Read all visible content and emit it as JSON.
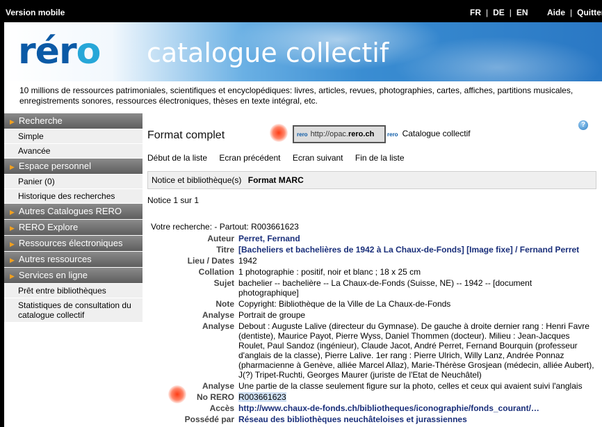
{
  "topbar": {
    "mobile": "Version mobile",
    "langs": [
      "FR",
      "DE",
      "EN"
    ],
    "help": "Aide",
    "quit": "Quitter"
  },
  "banner": {
    "logo": "rero",
    "title": "catalogue collectif"
  },
  "description": "10 millions de ressources patrimoniales, scientifiques et encyclopédiques: livres, articles, revues, photographies, cartes, affiches, partitions musicales, enregistrements sonores, ressources électroniques, thèses en texte intégral, etc.",
  "sidebar": {
    "recherche": "Recherche",
    "simple": "Simple",
    "avancee": "Avancée",
    "espace": "Espace personnel",
    "panier": "Panier (0)",
    "historique": "Historique des recherches",
    "autres_catalogues": "Autres Catalogues RERO",
    "explore": "RERO Explore",
    "ressources_elec": "Ressources électroniques",
    "autres_ressources": "Autres ressources",
    "services": "Services en ligne",
    "pret": "Prêt entre bibliothèques",
    "stats": "Statistiques de consultation du catalogue collectif"
  },
  "main": {
    "format_title": "Format complet",
    "url_prefix": "http://opac.",
    "url_bold": "rero.ch",
    "url_mini": "rero",
    "catalogue_label": "Catalogue collectif",
    "catalogue_mini": "rero",
    "help": "?",
    "nav": {
      "debut": "Début de la liste",
      "precedent": "Ecran précédent",
      "suivant": "Ecran suivant",
      "fin": "Fin de la liste"
    },
    "tabs": {
      "notice": "Notice et bibliothèque(s)",
      "marc": "Format MARC"
    },
    "notice_count": "Notice 1 sur 1",
    "recherche": "Votre recherche: - Partout: R003661623"
  },
  "record": {
    "auteur_l": "Auteur",
    "auteur": "Perret, Fernand",
    "titre_l": "Titre",
    "titre": "[Bacheliers et bachelières de 1942 à La Chaux-de-Fonds] [Image fixe] / Fernand Perret",
    "lieu_l": "Lieu / Dates",
    "lieu": "1942",
    "collation_l": "Collation",
    "collation": "1 photographie : positif, noir et blanc ; 18 x 25 cm",
    "sujet_l": "Sujet",
    "sujet": "bachelier -- bachelière -- La Chaux-de-Fonds (Suisse, NE) -- 1942 -- [document photographique]",
    "note_l": "Note",
    "note": "Copyright: Bibliothèque de la Ville de La Chaux-de-Fonds",
    "analyse1_l": "Analyse",
    "analyse1": "Portrait de groupe",
    "analyse2_l": "Analyse",
    "analyse2": "Debout : Auguste Lalive (directeur du Gymnase). De gauche à droite dernier rang : Henri Favre (dentiste), Maurice Payot, Pierre Wyss, Daniel Thommen (docteur). Milieu : Jean-Jacques Roulet, Paul Sandoz (ingénieur), Claude Jacot, André Perret, Fernand Bourquin (professeur d'anglais de la classe), Pierre Lalive. 1er rang : Pierre Ulrich, Willy Lanz, Andrée Ponnaz (pharmacienne à Genève, alliée Marcel Allaz), Marie-Thérèse Grosjean (médecin, alliée Aubert), J(?) Tripet-Ruchti, Georges Maurer (juriste de l'Etat de Neuchâtel)",
    "analyse3_l": "Analyse",
    "analyse3": "Une partie de la classe seulement figure sur la photo, celles et ceux qui avaient suivi l'anglais",
    "norero_l": "No RERO",
    "norero": "R003661623",
    "acces_l": "Accès",
    "acces": "http://www.chaux-de-fonds.ch/bibliotheques/iconographie/fonds_courant/…",
    "possede_l": "Possédé par",
    "possede": "Réseau des bibliothèques neuchâteloises et jurassiennes"
  }
}
